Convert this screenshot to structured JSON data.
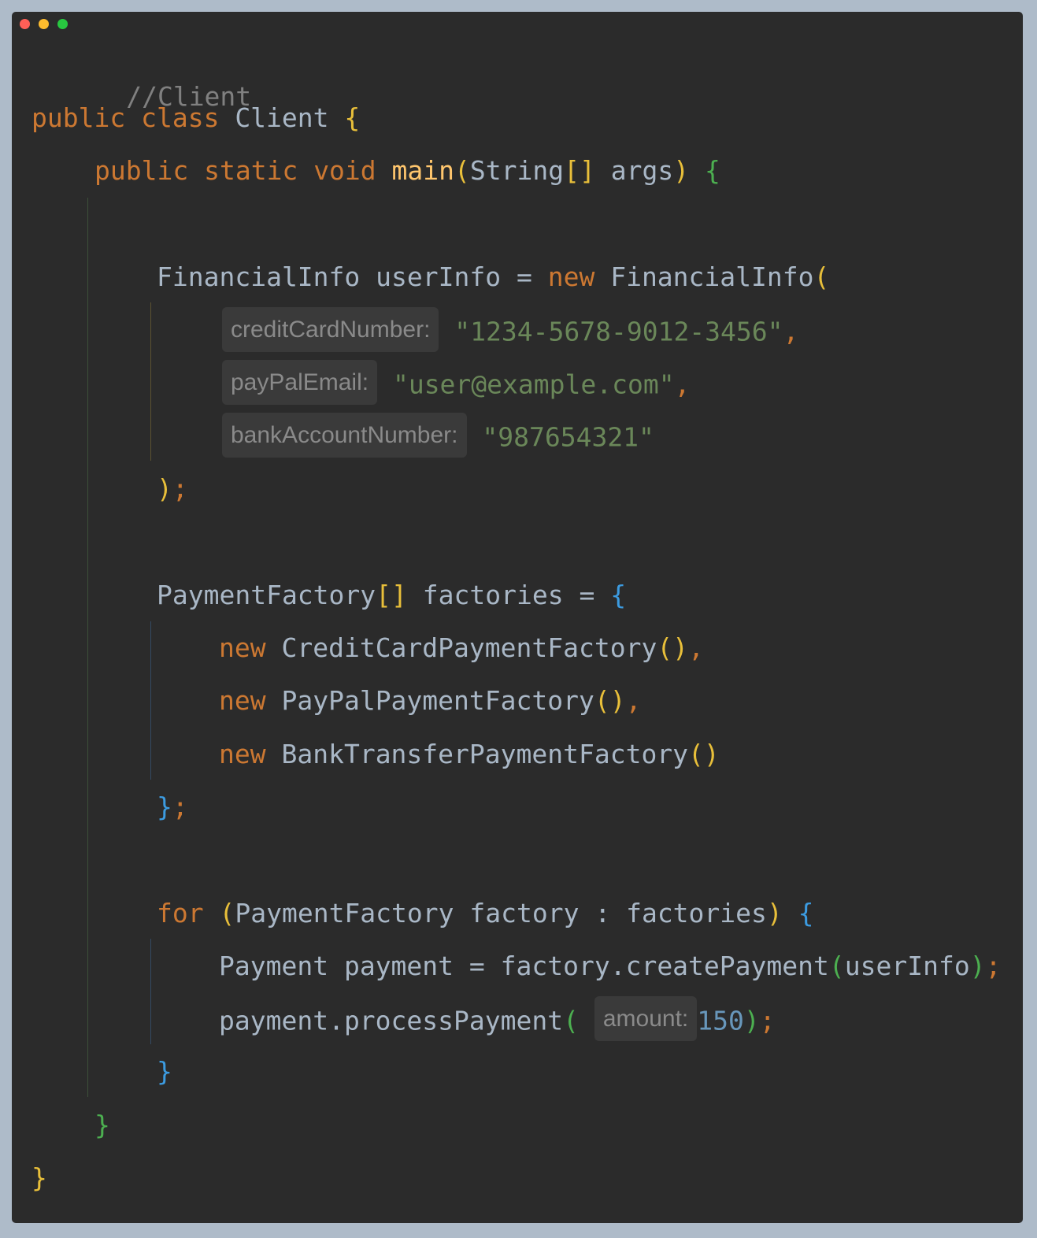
{
  "window": {
    "traffic_lights": {
      "close": "#fe5f57",
      "minimize": "#febc2e",
      "maximize": "#28c840"
    },
    "background": "#2b2b2b",
    "page_background": "#aebbc9"
  },
  "theme": {
    "keyword": "#cc7832",
    "comment": "#808080",
    "method": "#ffc66d",
    "string": "#6a8759",
    "number": "#6897bb",
    "text": "#a9b7c6"
  },
  "code": {
    "comment": "//Client",
    "kw_public": "public",
    "kw_class": "class",
    "kw_static": "static",
    "kw_void": "void",
    "kw_new": "new",
    "kw_for": "for",
    "class_name": "Client",
    "main_method": "main",
    "string_type": "String",
    "args": "args",
    "financial_info_type": "FinancialInfo",
    "user_info_var": "userInfo",
    "hint_credit_card": "creditCardNumber:",
    "credit_card_value": "\"1234-5678-9012-3456\"",
    "hint_paypal": "payPalEmail:",
    "paypal_value": "\"user@example.com\"",
    "hint_bank": "bankAccountNumber:",
    "bank_value": "\"987654321\"",
    "payment_factory_type": "PaymentFactory",
    "factories_var": "factories",
    "credit_card_factory": "CreditCardPaymentFactory",
    "paypal_factory": "PayPalPaymentFactory",
    "bank_factory": "BankTransferPaymentFactory",
    "factory_var": "factory",
    "payment_type": "Payment",
    "payment_var": "payment",
    "create_payment_call": "factory.createPayment",
    "process_payment_call": "payment.processPayment",
    "hint_amount": "amount:",
    "amount_value": "150"
  }
}
